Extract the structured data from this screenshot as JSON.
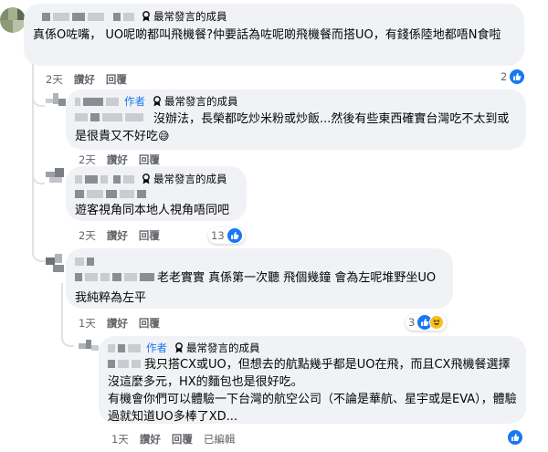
{
  "badge_label": "最常發言的成員",
  "author_label": "作者",
  "colors": {
    "like": "#1877f2",
    "meta": "#65676b",
    "bubble": "#f0f2f5"
  },
  "comments": [
    {
      "text": "真係O咗嘴， UO呢啲都叫飛機餐?仲要話為咗呢啲飛機餐而搭UO，有錢係陸地都唔N食啦",
      "time": "2天",
      "like_label": "讚好",
      "reply_label": "回覆",
      "reactions": "2"
    },
    {
      "text_tail": "沒辦法，長榮都吃炒米粉或炒飯...然後有些東西確實台灣吃不太到或是很貴又不好吃",
      "emoji": "😅",
      "time": "2天",
      "like_label": "讚好",
      "reply_label": "回覆"
    },
    {
      "text": "遊客視角同本地人視角唔同吧",
      "time": "2天",
      "like_label": "讚好",
      "reply_label": "回覆",
      "reactions": "13"
    },
    {
      "text_line1": "老老實實 真係第一次聽 飛個幾鐘 會為左呢堆野坐UO",
      "text_line2": "我純粹為左平",
      "time": "1天",
      "like_label": "讚好",
      "reply_label": "回覆",
      "reactions": "3"
    },
    {
      "text_line1": "我只搭CX或UO，但想去的航點幾乎都是UO在飛，而且CX飛機餐選擇沒這麼多元，HX的麵包也是很好吃。",
      "text_line2": "有機會你們可以體驗一下台灣的航空公司（不論是華航、星宇或是EVA），體驗過就知道UO多棒了XD...",
      "time": "1天",
      "like_label": "讚好",
      "reply_label": "回覆",
      "edited_label": "已編輯"
    }
  ]
}
